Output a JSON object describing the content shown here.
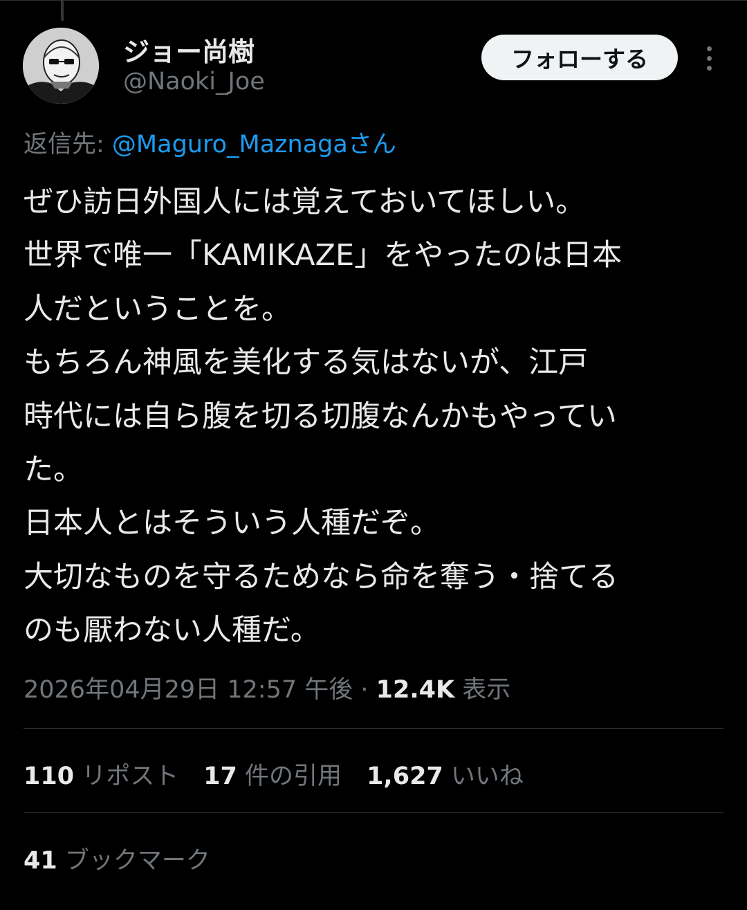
{
  "author": {
    "display_name": "ジョー尚樹",
    "handle": "@Naoki_Joe"
  },
  "follow_button": "フォローする",
  "reply": {
    "prefix": "返信先: ",
    "target": "@Maguro_Maznagaさん"
  },
  "tweet_lines": [
    "ぜひ訪日外国人には覚えておいてほしい。",
    "世界で唯一「KAMIKAZE」をやったのは日本",
    "人だということを。",
    "もちろん神風を美化する気はないが、江戸",
    "時代には自ら腹を切る切腹なんかもやってい",
    "た。",
    "日本人とはそういう人種だぞ。",
    "大切なものを守るためなら命を奪う・捨てる",
    "のも厭わない人種だ。"
  ],
  "meta": {
    "timestamp": "2026年04月29日 12:57 午後",
    "separator": " · ",
    "views_count": "12.4K",
    "views_label": " 表示"
  },
  "stats": {
    "reposts": {
      "count": "110",
      "label": " リポスト"
    },
    "quotes": {
      "count": "17",
      "label": " 件の引用"
    },
    "likes": {
      "count": "1,627",
      "label": " いいね"
    },
    "bookmarks": {
      "count": "41",
      "label": " ブックマーク"
    }
  },
  "colors": {
    "background": "#000000",
    "text_primary": "#e7e9ea",
    "text_secondary": "#71767b",
    "link": "#1d9bf0",
    "divider": "#2f3336",
    "follow_button_bg": "#eff3f4"
  },
  "icons": {
    "more": "more-vertical-icon"
  }
}
